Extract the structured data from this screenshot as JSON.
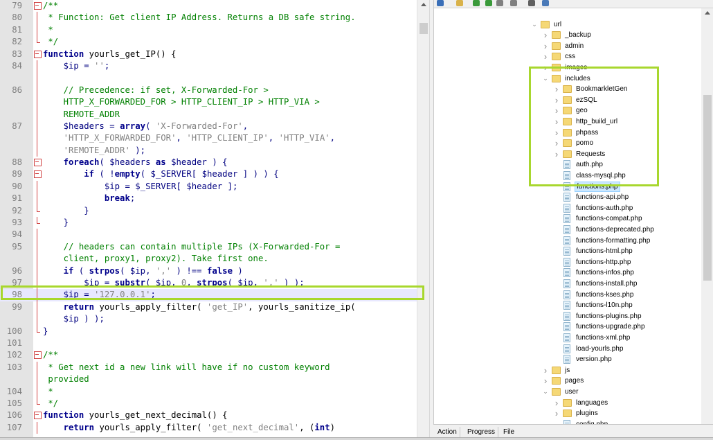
{
  "editor": {
    "lines": [
      {
        "n": "79",
        "fold": "box",
        "tokens": [
          [
            "com",
            "/**"
          ]
        ]
      },
      {
        "n": "80",
        "fold": "line",
        "tokens": [
          [
            "com",
            " * Function: Get client IP Address. Returns a DB safe string."
          ]
        ]
      },
      {
        "n": "81",
        "fold": "line",
        "tokens": [
          [
            "com",
            " *"
          ]
        ]
      },
      {
        "n": "82",
        "fold": "end",
        "tokens": [
          [
            "com",
            " */"
          ]
        ]
      },
      {
        "n": "83",
        "fold": "box",
        "tokens": [
          [
            "kw",
            "function"
          ],
          [
            "fn",
            " yourls_get_IP() {"
          ]
        ]
      },
      {
        "n": "84",
        "fold": "line",
        "tokens": [
          [
            "var",
            "    $ip"
          ],
          [
            "op",
            " = "
          ],
          [
            "str",
            "''"
          ],
          [
            "op",
            ";"
          ]
        ]
      },
      {
        "n": "",
        "fold": "line",
        "tokens": []
      },
      {
        "n": "86",
        "fold": "line",
        "tokens": [
          [
            "com",
            "    // Precedence: if set, X-Forwarded-For >"
          ]
        ]
      },
      {
        "n": "",
        "fold": "line",
        "tokens": [
          [
            "com",
            "    HTTP_X_FORWARDED_FOR > HTTP_CLIENT_IP > HTTP_VIA >"
          ]
        ]
      },
      {
        "n": "",
        "fold": "line",
        "tokens": [
          [
            "com",
            "    REMOTE_ADDR"
          ]
        ]
      },
      {
        "n": "87",
        "fold": "line",
        "tokens": [
          [
            "var",
            "    $headers"
          ],
          [
            "op",
            " = "
          ],
          [
            "kw",
            "array"
          ],
          [
            "op",
            "( "
          ],
          [
            "str",
            "'X-Forwarded-For'"
          ],
          [
            "op",
            ","
          ]
        ]
      },
      {
        "n": "",
        "fold": "line",
        "tokens": [
          [
            "str",
            "    'HTTP_X_FORWARDED_FOR'"
          ],
          [
            "op",
            ", "
          ],
          [
            "str",
            "'HTTP_CLIENT_IP'"
          ],
          [
            "op",
            ", "
          ],
          [
            "str",
            "'HTTP_VIA'"
          ],
          [
            "op",
            ","
          ]
        ]
      },
      {
        "n": "",
        "fold": "line",
        "tokens": [
          [
            "str",
            "    'REMOTE_ADDR'"
          ],
          [
            "op",
            " );"
          ]
        ]
      },
      {
        "n": "88",
        "fold": "box",
        "tokens": [
          [
            "kw",
            "    foreach"
          ],
          [
            "op",
            "( "
          ],
          [
            "var",
            "$headers"
          ],
          [
            "kw",
            " as"
          ],
          [
            "var",
            " $header"
          ],
          [
            "op",
            " ) {"
          ]
        ]
      },
      {
        "n": "89",
        "fold": "box",
        "tokens": [
          [
            "kw",
            "        if"
          ],
          [
            "op",
            " ( !"
          ],
          [
            "kw",
            "empty"
          ],
          [
            "op",
            "( "
          ],
          [
            "var",
            "$_SERVER"
          ],
          [
            "op",
            "[ "
          ],
          [
            "var",
            "$header"
          ],
          [
            "op",
            " ] ) ) {"
          ]
        ]
      },
      {
        "n": "90",
        "fold": "line",
        "tokens": [
          [
            "var",
            "            $ip"
          ],
          [
            "op",
            " = "
          ],
          [
            "var",
            "$_SERVER"
          ],
          [
            "op",
            "[ "
          ],
          [
            "var",
            "$header"
          ],
          [
            "op",
            " ];"
          ]
        ]
      },
      {
        "n": "91",
        "fold": "line",
        "tokens": [
          [
            "kw",
            "            break"
          ],
          [
            "op",
            ";"
          ]
        ]
      },
      {
        "n": "92",
        "fold": "end",
        "tokens": [
          [
            "op",
            "        }"
          ]
        ]
      },
      {
        "n": "93",
        "fold": "end",
        "tokens": [
          [
            "op",
            "    }"
          ]
        ]
      },
      {
        "n": "94",
        "fold": "line",
        "tokens": []
      },
      {
        "n": "95",
        "fold": "line",
        "tokens": [
          [
            "com",
            "    // headers can contain multiple IPs (X-Forwarded-For ="
          ]
        ]
      },
      {
        "n": "",
        "fold": "line",
        "tokens": [
          [
            "com",
            "    client, proxy1, proxy2). Take first one."
          ]
        ]
      },
      {
        "n": "96",
        "fold": "line",
        "tokens": [
          [
            "kw",
            "    if"
          ],
          [
            "op",
            " ( "
          ],
          [
            "kw",
            "strpos"
          ],
          [
            "op",
            "( "
          ],
          [
            "var",
            "$ip"
          ],
          [
            "op",
            ", "
          ],
          [
            "str",
            "','"
          ],
          [
            "op",
            " ) !== "
          ],
          [
            "kw",
            "false"
          ],
          [
            "op",
            " )"
          ]
        ]
      },
      {
        "n": "97",
        "fold": "line",
        "tokens": [
          [
            "var",
            "        $ip"
          ],
          [
            "op",
            " = "
          ],
          [
            "kw",
            "substr"
          ],
          [
            "op",
            "( "
          ],
          [
            "var",
            "$ip"
          ],
          [
            "op",
            ", "
          ],
          [
            "str",
            "0"
          ],
          [
            "op",
            ", "
          ],
          [
            "kw",
            "strpos"
          ],
          [
            "op",
            "( "
          ],
          [
            "var",
            "$ip"
          ],
          [
            "op",
            ", "
          ],
          [
            "str",
            "','"
          ],
          [
            "op",
            " ) );"
          ]
        ]
      },
      {
        "n": "98",
        "fold": "line",
        "hl": true,
        "tokens": [
          [
            "var",
            "    $ip"
          ],
          [
            "op",
            " = "
          ],
          [
            "str",
            "'127.0.0.1'"
          ],
          [
            "op",
            ";"
          ]
        ]
      },
      {
        "n": "99",
        "fold": "line",
        "tokens": [
          [
            "kw",
            "    return"
          ],
          [
            "fn",
            " yourls_apply_filter( "
          ],
          [
            "str",
            "'get_IP'"
          ],
          [
            "fn",
            ", yourls_sanitize_ip("
          ]
        ]
      },
      {
        "n": "",
        "fold": "line",
        "tokens": [
          [
            "var",
            "    $ip"
          ],
          [
            "op",
            " ) );"
          ]
        ]
      },
      {
        "n": "100",
        "fold": "end",
        "tokens": [
          [
            "op",
            "}"
          ]
        ]
      },
      {
        "n": "101",
        "fold": "",
        "tokens": []
      },
      {
        "n": "102",
        "fold": "box",
        "tokens": [
          [
            "com",
            "/**"
          ]
        ]
      },
      {
        "n": "103",
        "fold": "line",
        "tokens": [
          [
            "com",
            " * Get next id a new link will have if no custom keyword"
          ]
        ]
      },
      {
        "n": "",
        "fold": "line",
        "tokens": [
          [
            "com",
            " provided"
          ]
        ]
      },
      {
        "n": "104",
        "fold": "line",
        "tokens": [
          [
            "com",
            " *"
          ]
        ]
      },
      {
        "n": "105",
        "fold": "end",
        "tokens": [
          [
            "com",
            " */"
          ]
        ]
      },
      {
        "n": "106",
        "fold": "box",
        "tokens": [
          [
            "kw",
            "function"
          ],
          [
            "fn",
            " yourls_get_next_decimal() {"
          ]
        ]
      },
      {
        "n": "107",
        "fold": "line",
        "tokens": [
          [
            "kw",
            "    return"
          ],
          [
            "fn",
            " yourls_apply_filter( "
          ],
          [
            "str",
            "'get_next_decimal'"
          ],
          [
            "fn",
            ", ("
          ],
          [
            "kw",
            "int"
          ],
          [
            "fn",
            ")"
          ]
        ]
      }
    ]
  },
  "tree": {
    "items": [
      {
        "label": "url",
        "type": "folder",
        "depth": 0,
        "chev": "open"
      },
      {
        "label": "_backup",
        "type": "folder",
        "depth": 1,
        "chev": "closed"
      },
      {
        "label": "admin",
        "type": "folder",
        "depth": 1,
        "chev": "closed"
      },
      {
        "label": "css",
        "type": "folder",
        "depth": 1,
        "chev": "closed"
      },
      {
        "label": "images",
        "type": "folder",
        "depth": 1,
        "chev": "closed"
      },
      {
        "label": "includes",
        "type": "folder",
        "depth": 1,
        "chev": "open"
      },
      {
        "label": "BookmarkletGen",
        "type": "folder",
        "depth": 2,
        "chev": "closed"
      },
      {
        "label": "ezSQL",
        "type": "folder",
        "depth": 2,
        "chev": "closed"
      },
      {
        "label": "geo",
        "type": "folder",
        "depth": 2,
        "chev": "closed"
      },
      {
        "label": "http_build_url",
        "type": "folder",
        "depth": 2,
        "chev": "closed"
      },
      {
        "label": "phpass",
        "type": "folder",
        "depth": 2,
        "chev": "closed"
      },
      {
        "label": "pomo",
        "type": "folder",
        "depth": 2,
        "chev": "closed"
      },
      {
        "label": "Requests",
        "type": "folder",
        "depth": 2,
        "chev": "closed"
      },
      {
        "label": "auth.php",
        "type": "file",
        "depth": 2,
        "chev": ""
      },
      {
        "label": "class-mysql.php",
        "type": "file",
        "depth": 2,
        "chev": ""
      },
      {
        "label": "functions.php",
        "type": "file",
        "depth": 2,
        "chev": "",
        "selected": true
      },
      {
        "label": "functions-api.php",
        "type": "file",
        "depth": 2,
        "chev": ""
      },
      {
        "label": "functions-auth.php",
        "type": "file",
        "depth": 2,
        "chev": ""
      },
      {
        "label": "functions-compat.php",
        "type": "file",
        "depth": 2,
        "chev": ""
      },
      {
        "label": "functions-deprecated.php",
        "type": "file",
        "depth": 2,
        "chev": ""
      },
      {
        "label": "functions-formatting.php",
        "type": "file",
        "depth": 2,
        "chev": ""
      },
      {
        "label": "functions-html.php",
        "type": "file",
        "depth": 2,
        "chev": ""
      },
      {
        "label": "functions-http.php",
        "type": "file",
        "depth": 2,
        "chev": ""
      },
      {
        "label": "functions-infos.php",
        "type": "file",
        "depth": 2,
        "chev": ""
      },
      {
        "label": "functions-install.php",
        "type": "file",
        "depth": 2,
        "chev": ""
      },
      {
        "label": "functions-kses.php",
        "type": "file",
        "depth": 2,
        "chev": ""
      },
      {
        "label": "functions-l10n.php",
        "type": "file",
        "depth": 2,
        "chev": ""
      },
      {
        "label": "functions-plugins.php",
        "type": "file",
        "depth": 2,
        "chev": ""
      },
      {
        "label": "functions-upgrade.php",
        "type": "file",
        "depth": 2,
        "chev": ""
      },
      {
        "label": "functions-xml.php",
        "type": "file",
        "depth": 2,
        "chev": ""
      },
      {
        "label": "load-yourls.php",
        "type": "file",
        "depth": 2,
        "chev": ""
      },
      {
        "label": "version.php",
        "type": "file",
        "depth": 2,
        "chev": ""
      },
      {
        "label": "js",
        "type": "folder",
        "depth": 1,
        "chev": "closed"
      },
      {
        "label": "pages",
        "type": "folder",
        "depth": 1,
        "chev": "closed"
      },
      {
        "label": "user",
        "type": "folder",
        "depth": 1,
        "chev": "open"
      },
      {
        "label": "languages",
        "type": "folder",
        "depth": 2,
        "chev": "closed"
      },
      {
        "label": "plugins",
        "type": "folder",
        "depth": 2,
        "chev": "closed"
      },
      {
        "label": "config.php",
        "type": "file",
        "depth": 2,
        "chev": ""
      }
    ]
  },
  "toolbar_icons": [
    "sync-icon",
    "folder-icon",
    "download-icon",
    "upload-icon",
    "settings-icon",
    "stop-icon",
    "gear-icon",
    "list-icon"
  ],
  "bottom_tabs": {
    "action": "Action",
    "progress": "Progress",
    "file": "File"
  },
  "colors": {
    "highlight_border": "#a8d72e",
    "comment": "#008000",
    "keyword": "#00008b",
    "string": "#808080",
    "folder": "#f5d876",
    "selection": "#cce8ff"
  }
}
